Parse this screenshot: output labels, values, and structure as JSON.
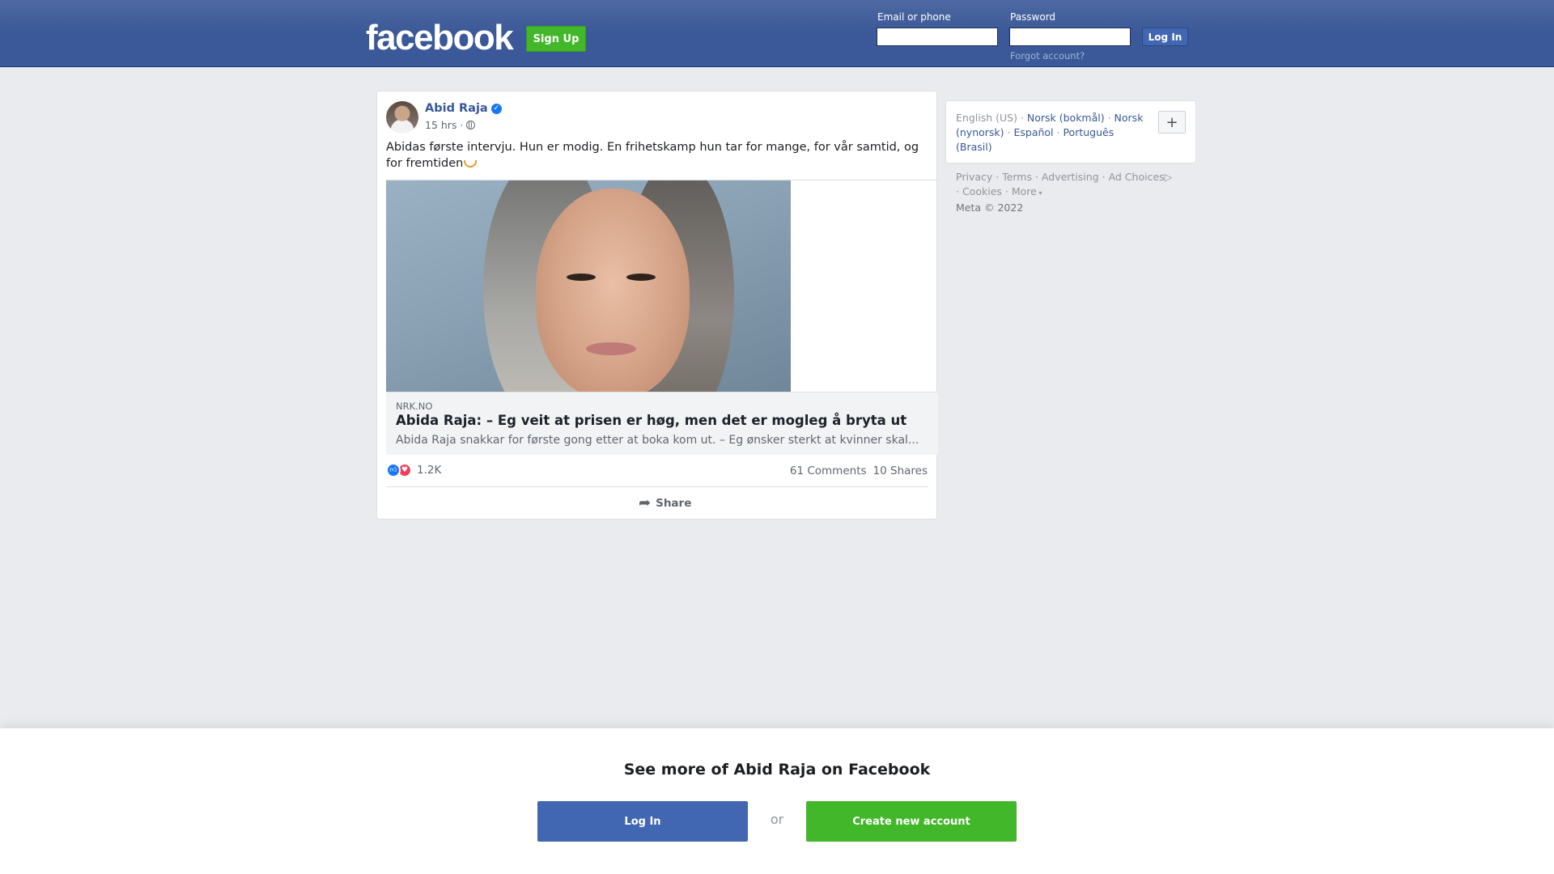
{
  "header": {
    "logo": "facebook",
    "signup_label": "Sign Up",
    "email_label": "Email or phone",
    "password_label": "Password",
    "login_label": "Log In",
    "forgot_label": "Forgot account?"
  },
  "post": {
    "author": "Abid Raja",
    "time": "15 hrs ·",
    "text": "Abidas første intervju. Hun er modig. En frihetskamp hun tar for mange, for vår samtid, og for fremtiden",
    "link": {
      "domain": "NRK.NO",
      "title": "Abida Raja: – Eg veit at prisen er høg, men det er mogleg å bryta ut",
      "description": "Abida Raja snakkar for første gong etter at boka kom ut. – Eg ønsker sterkt at kvinner skal..."
    },
    "reaction_count": "1.2K",
    "comments": "61 Comments",
    "shares": "10 Shares",
    "share_label": "Share"
  },
  "languages": {
    "current": "English (US)",
    "items": [
      "Norsk (bokmål)",
      "Norsk (nynorsk)",
      "Español",
      "Português (Brasil)"
    ],
    "add_label": "+"
  },
  "footer": {
    "links": [
      "Privacy",
      "Terms",
      "Advertising",
      "Ad Choices",
      "Cookies",
      "More"
    ],
    "copyright": "Meta © 2022"
  },
  "banner": {
    "title": "See more of Abid Raja on Facebook",
    "login_label": "Log In",
    "or_label": "or",
    "create_label": "Create new account"
  },
  "colors": {
    "brand_blue": "#3b5998",
    "signup_green": "#42b72a",
    "link_blue": "#385898"
  },
  "icons": [
    "verified-icon",
    "globe-icon",
    "emoji-icon",
    "like-icon",
    "love-icon",
    "share-icon",
    "ad-choices-icon",
    "more-caret-icon"
  ]
}
